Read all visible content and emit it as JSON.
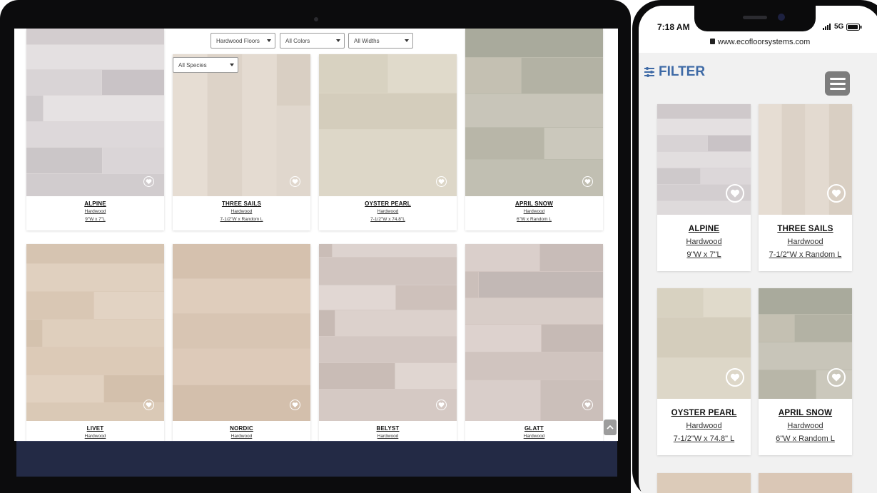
{
  "desktop": {
    "filters": {
      "category": "Hardwood Floors",
      "colors": "All Colors",
      "widths": "All Widths",
      "species": "All Species"
    },
    "products": [
      {
        "name": "ALPINE",
        "type": "Hardwood",
        "size": "9\"W x 7\"L"
      },
      {
        "name": "THREE SAILS",
        "type": "Hardwood",
        "size": "7-1/2\"W x Random L"
      },
      {
        "name": "OYSTER PEARL",
        "type": "Hardwood",
        "size": "7-1/2\"W x 74.8\"L"
      },
      {
        "name": "APRIL SNOW",
        "type": "Hardwood",
        "size": "6\"W x Random L"
      },
      {
        "name": "LIVET",
        "type": "Hardwood"
      },
      {
        "name": "NORDIC",
        "type": "Hardwood"
      },
      {
        "name": "BELYST",
        "type": "Hardwood"
      },
      {
        "name": "GLATT",
        "type": "Hardwood"
      }
    ]
  },
  "mobile": {
    "status": {
      "time": "7:18 AM",
      "network": "5G"
    },
    "url": "www.ecofloorsystems.com",
    "filter_label": "FILTER",
    "products": [
      {
        "name": "ALPINE",
        "type": "Hardwood",
        "size": "9\"W x 7\"L"
      },
      {
        "name": "THREE SAILS",
        "type": "Hardwood",
        "size": "7-1/2\"W x Random L"
      },
      {
        "name": "OYSTER PEARL",
        "type": "Hardwood",
        "size": "7-1/2\"W x 74.8\" L"
      },
      {
        "name": "APRIL SNOW",
        "type": "Hardwood",
        "size": "6\"W x Random L"
      }
    ]
  },
  "icons": {
    "favorite": "heart-icon",
    "filter": "sliders-icon",
    "menu": "hamburger-icon",
    "back_to_top": "chevron-up-icon",
    "lock": "lock-icon"
  },
  "colors": {
    "filter_blue": "#3e6aa6",
    "footer_navy": "#232a45",
    "menu_gray": "#7d7d7d"
  }
}
